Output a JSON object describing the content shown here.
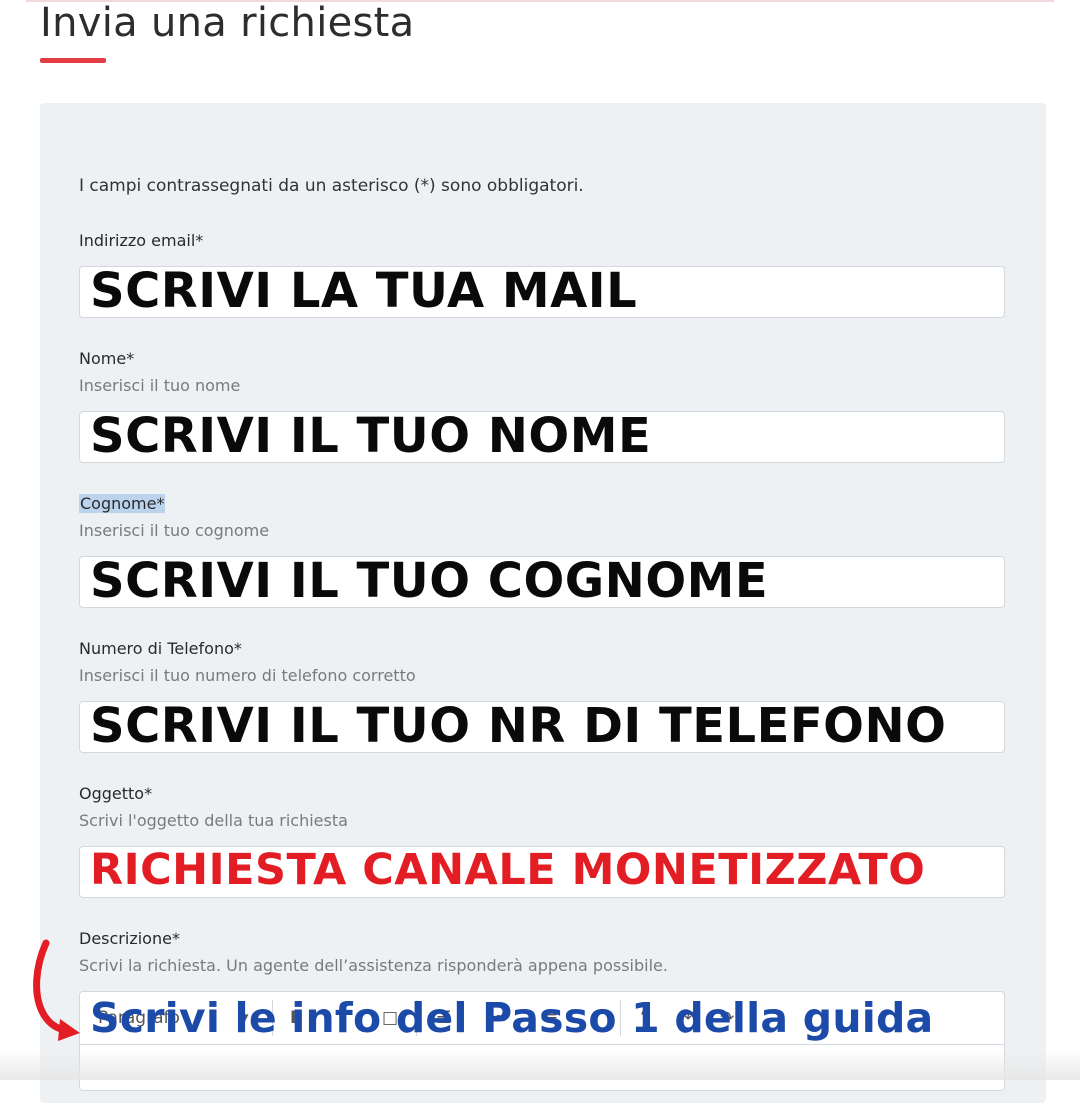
{
  "page": {
    "title": "Invia una richiesta"
  },
  "form": {
    "required_note": "I campi contrassegnati da un asterisco (*) sono obbligatori.",
    "email": {
      "label": "Indirizzo email*",
      "value": "SCRIVI LA TUA MAIL"
    },
    "nome": {
      "label": "Nome*",
      "hint": "Inserisci il tuo nome",
      "value": "SCRIVI IL TUO NOME"
    },
    "cognome": {
      "label": "Cognome*",
      "hint": "Inserisci il tuo cognome",
      "value": "SCRIVI IL TUO COGNOME"
    },
    "telefono": {
      "label": "Numero di Telefono*",
      "hint": "Inserisci il tuo numero di telefono corretto",
      "value": "SCRIVI IL TUO NR DI TELEFONO"
    },
    "oggetto": {
      "label": "Oggetto*",
      "hint": "Scrivi l'oggetto della tua richiesta",
      "value": "RICHIESTA CANALE MONETIZZATO"
    },
    "descrizione": {
      "label": "Descrizione*",
      "hint": "Scrivi la richiesta. Un agente dell’assistenza risponderà appena possibile.",
      "toolbar": {
        "paragraph_label": "Paragrafo",
        "bold": "B",
        "italic": "I"
      }
    }
  },
  "annotation": {
    "text": "Scrivi le info del Passo 1 della guida",
    "arrow_icon": "curved-arrow-icon"
  },
  "colors": {
    "accent": "#e43d45",
    "overlay_red": "#e21e24",
    "overlay_blue": "#1b4aa8",
    "panel": "#eef1f3"
  }
}
